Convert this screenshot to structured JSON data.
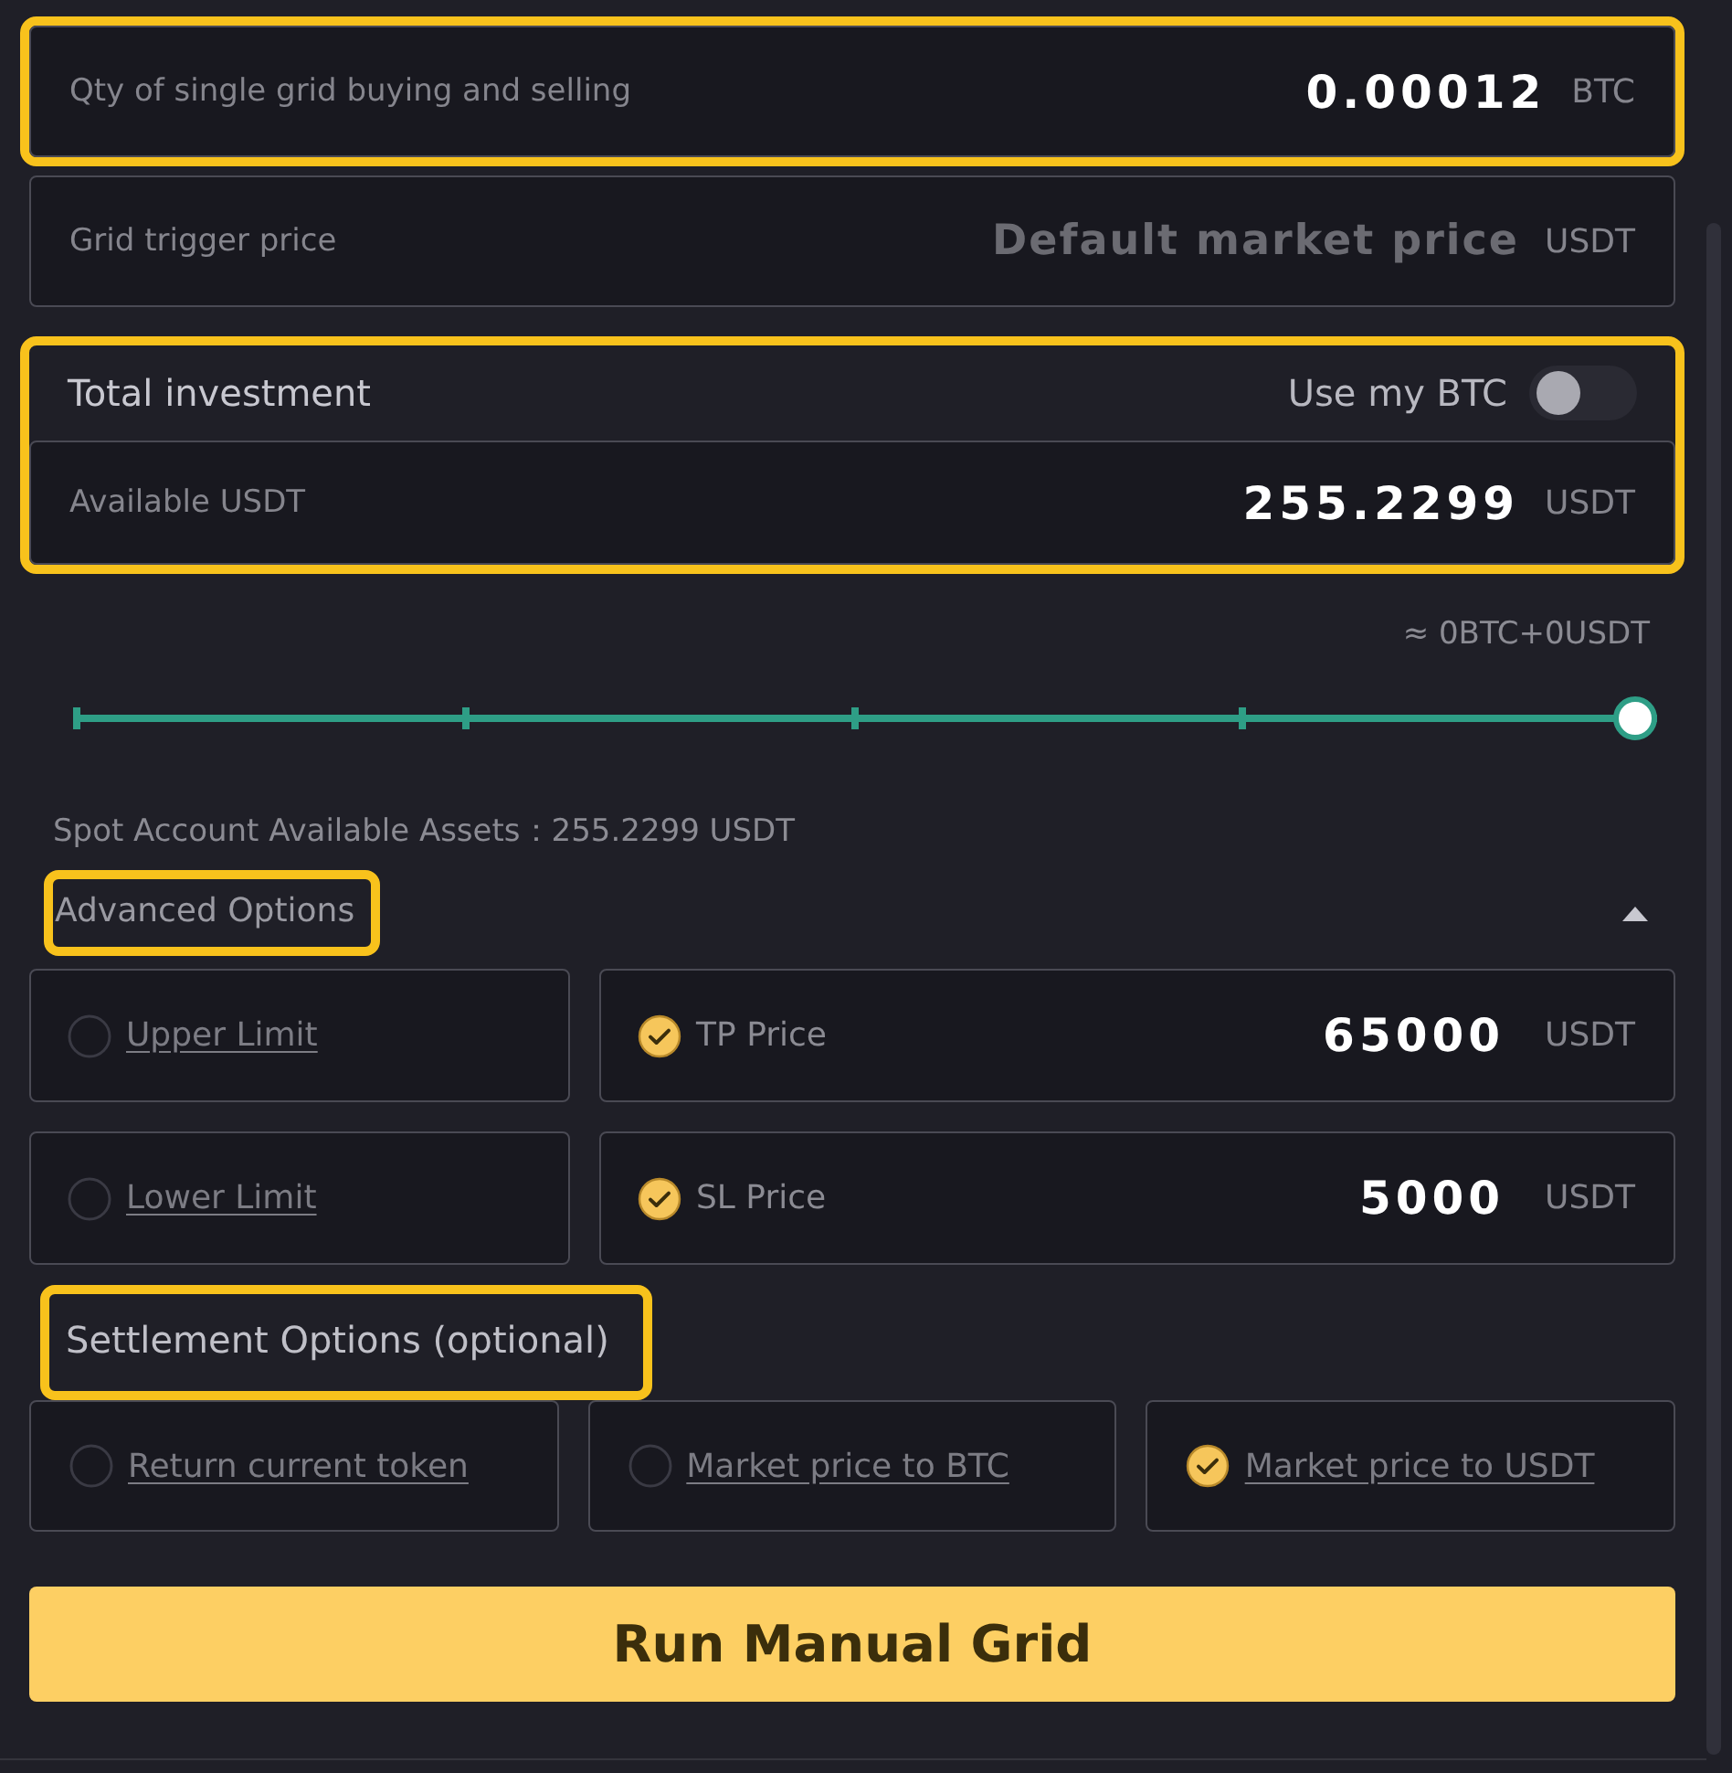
{
  "fields": [
    {
      "label": "Qty of single grid buying and selling",
      "value": "0.00012",
      "unit": "BTC",
      "highlighted": true
    },
    {
      "label": "Grid trigger price",
      "placeholder": "Default market price",
      "unit": "USDT",
      "highlighted": false
    }
  ],
  "investment": {
    "title": "Total investment",
    "highlighted": true,
    "toggle": {
      "label": "Use my BTC",
      "on": false
    },
    "field": {
      "label": "Available USDT",
      "value": "255.2299",
      "unit": "USDT"
    }
  },
  "estimate": "≈ 0BTC+0USDT",
  "slider": {
    "level": 1
  },
  "spot_available": "Spot Account Available Assets：255.2299 USDT",
  "advanced": {
    "title": "Advanced Options",
    "highlighted": true,
    "expanded": true,
    "options": [
      {
        "label": "Upper Limit",
        "checked": false
      },
      {
        "label": "TP Price",
        "checked": true,
        "value": "65000",
        "unit": "USDT"
      },
      {
        "label": "Lower Limit",
        "checked": false
      },
      {
        "label": "SL Price",
        "checked": true,
        "value": "5000",
        "unit": "USDT"
      }
    ]
  },
  "settlement": {
    "title": "Settlement Options (optional)",
    "highlighted": true,
    "options": [
      {
        "label": "Return current token",
        "selected": false
      },
      {
        "label": "Market price to BTC",
        "selected": false
      },
      {
        "label": "Market price to USDT",
        "selected": true
      }
    ]
  },
  "button": {
    "label": "Run Manual Grid"
  }
}
